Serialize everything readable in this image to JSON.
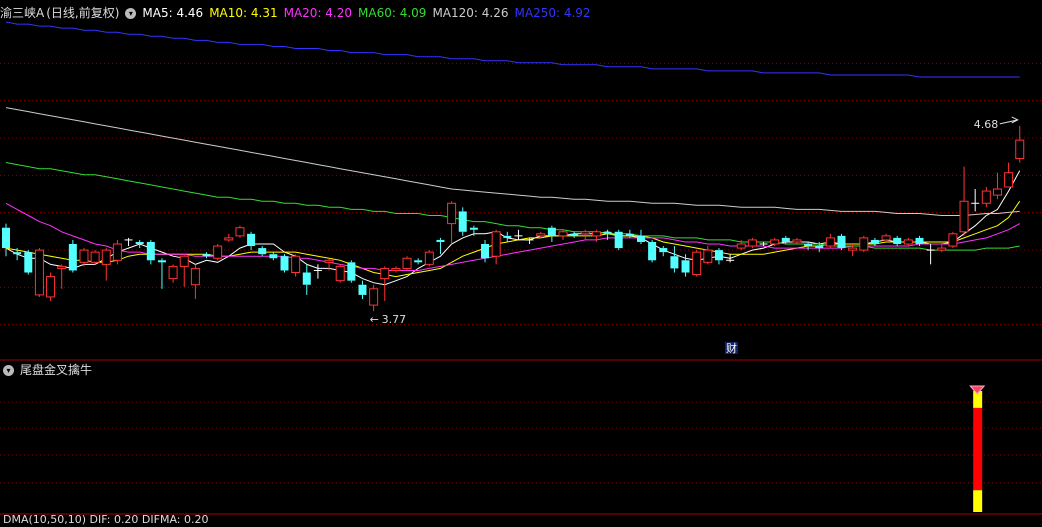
{
  "header": {
    "title": "渝三峡A",
    "mode": "(日线,前复权)",
    "ma_labels": [
      {
        "text": "MA5: 4.46",
        "color": "#ffffff"
      },
      {
        "text": "MA10: 4.31",
        "color": "#ffff00"
      },
      {
        "text": "MA20: 4.20",
        "color": "#ff33ff"
      },
      {
        "text": "MA60: 4.09",
        "color": "#33dd33"
      },
      {
        "text": "MA120: 4.26",
        "color": "#cccccc"
      },
      {
        "text": "MA250: 4.92",
        "color": "#3333ff"
      }
    ]
  },
  "indicator": {
    "title": "尾盘金叉擒牛"
  },
  "bottom": {
    "text": "DMA(10,50,10) DIF: 0.20 DIFMA: 0.20"
  },
  "chart_data": {
    "type": "candlestick",
    "ylim": [
      3.55,
      5.2
    ],
    "annotations": {
      "low_label": "3.77",
      "high_label": "4.68",
      "event_marker": "财"
    },
    "candles": [
      [
        4.18,
        4.08,
        4.2,
        4.04
      ],
      [
        4.06,
        4.05,
        4.08,
        4.02
      ],
      [
        4.06,
        3.96,
        4.07,
        3.95
      ],
      [
        3.85,
        4.07,
        4.08,
        3.84
      ],
      [
        3.84,
        3.94,
        3.96,
        3.82
      ],
      [
        3.98,
        3.99,
        4.0,
        3.88
      ],
      [
        4.1,
        3.97,
        4.12,
        3.96
      ],
      [
        4.01,
        4.07,
        4.08,
        3.99
      ],
      [
        4.01,
        4.06,
        4.07,
        4.0
      ],
      [
        4.0,
        4.07,
        4.08,
        3.92
      ],
      [
        4.02,
        4.1,
        4.12,
        4.0
      ],
      [
        4.12,
        4.12,
        4.13,
        4.09
      ],
      [
        4.11,
        4.1,
        4.12,
        4.08
      ],
      [
        4.11,
        4.02,
        4.12,
        4.0
      ],
      [
        4.02,
        4.01,
        4.03,
        3.88
      ],
      [
        3.93,
        3.99,
        4.0,
        3.91
      ],
      [
        3.99,
        4.04,
        4.05,
        3.89
      ],
      [
        3.9,
        3.98,
        4.0,
        3.83
      ],
      [
        4.05,
        4.04,
        4.06,
        4.03
      ],
      [
        4.03,
        4.09,
        4.1,
        4.02
      ],
      [
        4.12,
        4.13,
        4.15,
        4.11
      ],
      [
        4.14,
        4.18,
        4.19,
        4.13
      ],
      [
        4.15,
        4.09,
        4.16,
        4.07
      ],
      [
        4.08,
        4.05,
        4.09,
        4.04
      ],
      [
        4.05,
        4.03,
        4.06,
        4.02
      ],
      [
        4.04,
        3.97,
        4.05,
        3.96
      ],
      [
        3.96,
        4.04,
        4.05,
        3.94
      ],
      [
        3.96,
        3.9,
        4.0,
        3.85
      ],
      [
        3.97,
        3.97,
        4.0,
        3.93
      ],
      [
        4.01,
        4.02,
        4.03,
        3.97
      ],
      [
        3.92,
        3.99,
        4.0,
        3.91
      ],
      [
        4.01,
        3.92,
        4.02,
        3.91
      ],
      [
        3.9,
        3.85,
        3.92,
        3.83
      ],
      [
        3.8,
        3.88,
        3.9,
        3.77
      ],
      [
        3.93,
        3.98,
        3.99,
        3.82
      ],
      [
        3.97,
        3.98,
        3.99,
        3.96
      ],
      [
        3.98,
        4.03,
        4.04,
        3.97
      ],
      [
        4.02,
        4.01,
        4.03,
        4.0
      ],
      [
        4.0,
        4.06,
        4.07,
        3.99
      ],
      [
        4.12,
        4.11,
        4.13,
        4.05
      ],
      [
        4.2,
        4.3,
        4.31,
        4.1
      ],
      [
        4.26,
        4.16,
        4.28,
        4.14
      ],
      [
        4.18,
        4.17,
        4.19,
        4.14
      ],
      [
        4.1,
        4.03,
        4.12,
        4.01
      ],
      [
        4.04,
        4.16,
        4.17,
        4.0
      ],
      [
        4.14,
        4.13,
        4.16,
        4.11
      ],
      [
        4.14,
        4.14,
        4.17,
        4.12
      ],
      [
        4.12,
        4.12,
        4.13,
        4.1
      ],
      [
        4.14,
        4.15,
        4.16,
        4.13
      ],
      [
        4.18,
        4.14,
        4.19,
        4.11
      ],
      [
        4.14,
        4.16,
        4.17,
        4.12
      ],
      [
        4.15,
        4.14,
        4.16,
        4.13
      ],
      [
        4.15,
        4.16,
        4.17,
        4.12
      ],
      [
        4.14,
        4.16,
        4.17,
        4.11
      ],
      [
        4.16,
        4.15,
        4.17,
        4.12
      ],
      [
        4.16,
        4.08,
        4.17,
        4.07
      ],
      [
        4.15,
        4.14,
        4.17,
        4.13
      ],
      [
        4.14,
        4.11,
        4.17,
        4.1
      ],
      [
        4.11,
        4.02,
        4.12,
        4.01
      ],
      [
        4.08,
        4.06,
        4.09,
        4.04
      ],
      [
        4.04,
        3.98,
        4.09,
        3.96
      ],
      [
        4.02,
        3.96,
        4.05,
        3.94
      ],
      [
        3.95,
        4.06,
        4.07,
        3.94
      ],
      [
        4.01,
        4.07,
        4.09,
        4.0
      ],
      [
        4.07,
        4.02,
        4.08,
        4.0
      ],
      [
        4.02,
        4.02,
        4.05,
        4.01
      ],
      [
        4.08,
        4.1,
        4.12,
        4.07
      ],
      [
        4.09,
        4.12,
        4.13,
        4.08
      ],
      [
        4.1,
        4.1,
        4.11,
        4.09
      ],
      [
        4.1,
        4.12,
        4.13,
        4.09
      ],
      [
        4.13,
        4.11,
        4.14,
        4.1
      ],
      [
        4.11,
        4.12,
        4.13,
        4.1
      ],
      [
        4.1,
        4.09,
        4.11,
        4.07
      ],
      [
        4.09,
        4.08,
        4.11,
        4.06
      ],
      [
        4.09,
        4.13,
        4.15,
        4.08
      ],
      [
        4.14,
        4.08,
        4.15,
        4.07
      ],
      [
        4.07,
        4.08,
        4.1,
        4.04
      ],
      [
        4.07,
        4.13,
        4.14,
        4.06
      ],
      [
        4.12,
        4.1,
        4.13,
        4.09
      ],
      [
        4.12,
        4.14,
        4.15,
        4.11
      ],
      [
        4.13,
        4.1,
        4.14,
        4.09
      ],
      [
        4.1,
        4.12,
        4.13,
        4.09
      ],
      [
        4.13,
        4.1,
        4.14,
        4.09
      ],
      [
        4.07,
        4.07,
        4.1,
        4.0
      ],
      [
        4.07,
        4.08,
        4.11,
        4.06
      ],
      [
        4.09,
        4.15,
        4.16,
        4.08
      ],
      [
        4.16,
        4.31,
        4.48,
        4.14
      ],
      [
        4.3,
        4.3,
        4.37,
        4.26
      ],
      [
        4.3,
        4.36,
        4.38,
        4.28
      ],
      [
        4.34,
        4.37,
        4.45,
        4.32
      ],
      [
        4.38,
        4.45,
        4.5,
        4.38
      ],
      [
        4.52,
        4.61,
        4.68,
        4.5
      ]
    ],
    "ma": [
      {
        "name": "MA5",
        "color": "#ffffff",
        "values": [
          4.08,
          4.05,
          4.03,
          4.03,
          4.0,
          3.99,
          3.98,
          4.0,
          4.0,
          4.03,
          4.06,
          4.08,
          4.1,
          4.08,
          4.06,
          4.04,
          4.03,
          4.0,
          4.02,
          4.01,
          4.04,
          4.08,
          4.1,
          4.1,
          4.1,
          4.06,
          4.04,
          4.0,
          3.98,
          3.98,
          3.97,
          3.96,
          3.93,
          3.91,
          3.9,
          3.92,
          3.94,
          3.98,
          4.01,
          4.04,
          4.1,
          4.13,
          4.15,
          4.15,
          4.16,
          4.13,
          4.12,
          4.12,
          4.14,
          4.14,
          4.14,
          4.15,
          4.15,
          4.15,
          4.16,
          4.14,
          4.14,
          4.13,
          4.1,
          4.07,
          4.05,
          4.03,
          4.02,
          4.03,
          4.04,
          4.03,
          4.05,
          4.07,
          4.08,
          4.1,
          4.11,
          4.11,
          4.11,
          4.1,
          4.11,
          4.1,
          4.1,
          4.1,
          4.11,
          4.12,
          4.11,
          4.11,
          4.11,
          4.1,
          4.1,
          4.11,
          4.15,
          4.19,
          4.24,
          4.27,
          4.36,
          4.46
        ]
      },
      {
        "name": "MA10",
        "color": "#ffff00",
        "values": [
          4.08,
          4.07,
          4.06,
          4.05,
          4.04,
          4.03,
          4.02,
          4.02,
          4.01,
          4.01,
          4.02,
          4.04,
          4.05,
          4.05,
          4.05,
          4.05,
          4.05,
          4.05,
          4.05,
          4.04,
          4.04,
          4.05,
          4.06,
          4.06,
          4.06,
          4.06,
          4.06,
          4.05,
          4.04,
          4.03,
          4.02,
          4.0,
          3.98,
          3.96,
          3.95,
          3.94,
          3.95,
          3.96,
          3.97,
          3.98,
          4.01,
          4.04,
          4.06,
          4.08,
          4.1,
          4.11,
          4.12,
          4.13,
          4.13,
          4.14,
          4.14,
          4.14,
          4.14,
          4.14,
          4.15,
          4.14,
          4.14,
          4.14,
          4.13,
          4.11,
          4.1,
          4.09,
          4.08,
          4.07,
          4.06,
          4.05,
          4.05,
          4.05,
          4.05,
          4.06,
          4.07,
          4.08,
          4.09,
          4.09,
          4.1,
          4.1,
          4.1,
          4.1,
          4.1,
          4.11,
          4.11,
          4.11,
          4.11,
          4.11,
          4.11,
          4.11,
          4.13,
          4.15,
          4.17,
          4.19,
          4.23,
          4.31
        ]
      },
      {
        "name": "MA20",
        "color": "#ff33ff",
        "values": [
          4.3,
          4.27,
          4.24,
          4.21,
          4.19,
          4.16,
          4.14,
          4.12,
          4.1,
          4.09,
          4.07,
          4.06,
          4.06,
          4.05,
          4.05,
          4.05,
          4.05,
          4.04,
          4.04,
          4.04,
          4.04,
          4.04,
          4.04,
          4.04,
          4.04,
          4.04,
          4.03,
          4.03,
          4.02,
          4.01,
          4.0,
          3.99,
          3.98,
          3.98,
          3.97,
          3.97,
          3.97,
          3.97,
          3.98,
          3.99,
          4.0,
          4.01,
          4.02,
          4.03,
          4.04,
          4.05,
          4.06,
          4.07,
          4.08,
          4.09,
          4.1,
          4.11,
          4.12,
          4.12,
          4.13,
          4.13,
          4.13,
          4.13,
          4.13,
          4.13,
          4.12,
          4.11,
          4.11,
          4.1,
          4.1,
          4.09,
          4.09,
          4.09,
          4.09,
          4.08,
          4.08,
          4.08,
          4.08,
          4.08,
          4.08,
          4.08,
          4.09,
          4.09,
          4.09,
          4.09,
          4.09,
          4.09,
          4.1,
          4.1,
          4.1,
          4.1,
          4.11,
          4.12,
          4.13,
          4.15,
          4.17,
          4.2
        ]
      },
      {
        "name": "MA60",
        "color": "#33dd33",
        "values": [
          4.5,
          4.49,
          4.48,
          4.47,
          4.47,
          4.46,
          4.45,
          4.44,
          4.44,
          4.43,
          4.42,
          4.41,
          4.4,
          4.39,
          4.38,
          4.37,
          4.36,
          4.35,
          4.34,
          4.33,
          4.33,
          4.32,
          4.32,
          4.31,
          4.31,
          4.3,
          4.3,
          4.29,
          4.29,
          4.28,
          4.28,
          4.27,
          4.27,
          4.26,
          4.26,
          4.25,
          4.25,
          4.25,
          4.24,
          4.24,
          4.23,
          4.22,
          4.21,
          4.21,
          4.2,
          4.19,
          4.19,
          4.18,
          4.18,
          4.17,
          4.17,
          4.16,
          4.16,
          4.16,
          4.15,
          4.15,
          4.15,
          4.14,
          4.14,
          4.14,
          4.13,
          4.13,
          4.13,
          4.12,
          4.12,
          4.12,
          4.11,
          4.11,
          4.11,
          4.11,
          4.1,
          4.1,
          4.1,
          4.1,
          4.09,
          4.09,
          4.09,
          4.09,
          4.08,
          4.08,
          4.08,
          4.08,
          4.08,
          4.07,
          4.07,
          4.07,
          4.07,
          4.07,
          4.08,
          4.08,
          4.08,
          4.09
        ]
      },
      {
        "name": "MA120",
        "color": "#cccccc",
        "values": [
          4.77,
          4.76,
          4.75,
          4.74,
          4.73,
          4.72,
          4.71,
          4.7,
          4.69,
          4.68,
          4.67,
          4.66,
          4.65,
          4.64,
          4.63,
          4.62,
          4.61,
          4.6,
          4.59,
          4.58,
          4.57,
          4.56,
          4.55,
          4.54,
          4.53,
          4.52,
          4.51,
          4.5,
          4.49,
          4.48,
          4.47,
          4.46,
          4.45,
          4.44,
          4.43,
          4.42,
          4.41,
          4.4,
          4.39,
          4.38,
          4.37,
          4.365,
          4.36,
          4.355,
          4.35,
          4.345,
          4.34,
          4.335,
          4.33,
          4.33,
          4.325,
          4.32,
          4.32,
          4.315,
          4.31,
          4.31,
          4.31,
          4.305,
          4.3,
          4.3,
          4.3,
          4.295,
          4.29,
          4.29,
          4.29,
          4.285,
          4.28,
          4.28,
          4.28,
          4.28,
          4.275,
          4.27,
          4.27,
          4.27,
          4.265,
          4.26,
          4.26,
          4.26,
          4.26,
          4.255,
          4.25,
          4.25,
          4.25,
          4.245,
          4.24,
          4.24,
          4.24,
          4.245,
          4.25,
          4.25,
          4.255,
          4.26
        ]
      },
      {
        "name": "MA250",
        "color": "#3333ff",
        "values": [
          5.19,
          5.18,
          5.18,
          5.17,
          5.17,
          5.16,
          5.16,
          5.15,
          5.15,
          5.14,
          5.14,
          5.13,
          5.13,
          5.12,
          5.12,
          5.11,
          5.11,
          5.1,
          5.1,
          5.09,
          5.09,
          5.08,
          5.08,
          5.08,
          5.07,
          5.07,
          5.06,
          5.06,
          5.06,
          5.05,
          5.05,
          5.04,
          5.04,
          5.04,
          5.03,
          5.03,
          5.03,
          5.02,
          5.02,
          5.02,
          5.01,
          5.01,
          5.01,
          5.0,
          5.0,
          5.0,
          4.99,
          4.99,
          4.99,
          4.99,
          4.98,
          4.98,
          4.98,
          4.98,
          4.97,
          4.97,
          4.97,
          4.97,
          4.96,
          4.96,
          4.96,
          4.96,
          4.96,
          4.95,
          4.95,
          4.95,
          4.95,
          4.95,
          4.94,
          4.94,
          4.94,
          4.94,
          4.94,
          4.94,
          4.93,
          4.93,
          4.93,
          4.93,
          4.93,
          4.93,
          4.93,
          4.93,
          4.92,
          4.92,
          4.92,
          4.92,
          4.92,
          4.92,
          4.92,
          4.92,
          4.92,
          4.92
        ]
      }
    ],
    "signal": {
      "index": 87,
      "segments": [
        "#ffff00",
        "#ff0000",
        "#ffff00"
      ]
    }
  }
}
